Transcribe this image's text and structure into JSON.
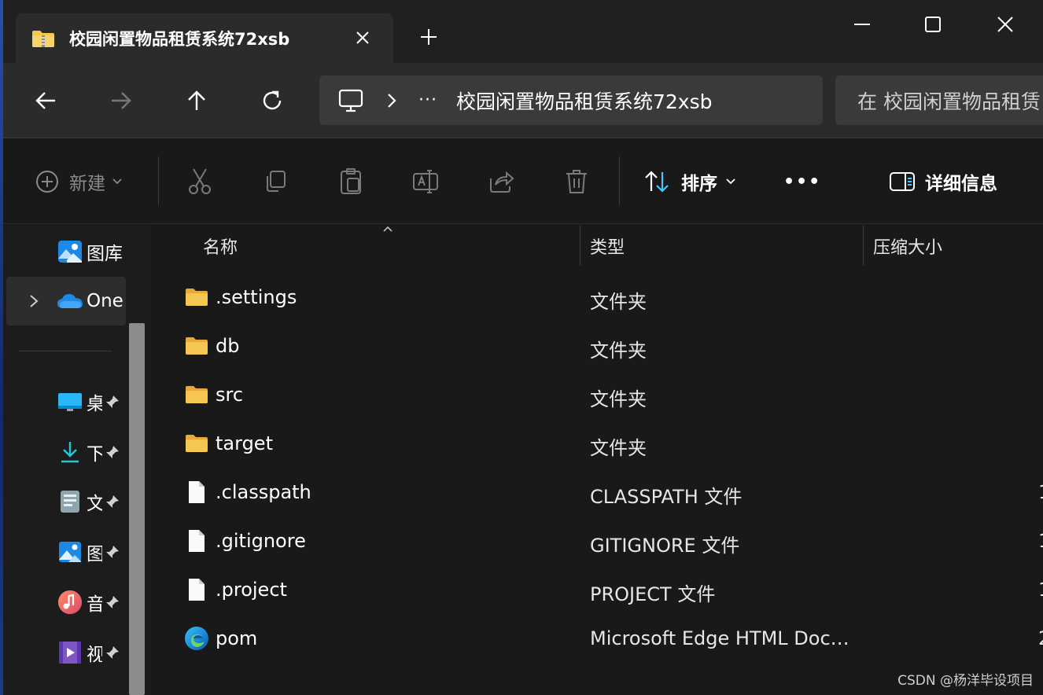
{
  "window": {
    "tab_title": "校园闲置物品租赁系统72xsb",
    "tab_icon": "zip-folder-icon"
  },
  "address": {
    "path_text": "校园闲置物品租赁系统72xsb",
    "more_label": "···",
    "search_placeholder": "在 校园闲置物品租赁"
  },
  "command_bar": {
    "new_label": "新建",
    "sort_label": "排序",
    "more_label": "•••",
    "details_label": "详细信息"
  },
  "sidebar": {
    "items": [
      {
        "label": "图库",
        "icon": "gallery-icon"
      },
      {
        "label": "One",
        "icon": "onedrive-icon"
      },
      {
        "label": "桌",
        "icon": "desktop-icon"
      },
      {
        "label": "下",
        "icon": "downloads-icon"
      },
      {
        "label": "文",
        "icon": "documents-icon"
      },
      {
        "label": "图",
        "icon": "pictures-icon"
      },
      {
        "label": "音",
        "icon": "music-icon"
      },
      {
        "label": "视",
        "icon": "videos-icon"
      }
    ]
  },
  "columns": {
    "name": "名称",
    "type": "类型",
    "compressed_size": "压缩大小"
  },
  "files": [
    {
      "name": ".settings",
      "type": "文件夹",
      "size": "",
      "icon": "folder-icon"
    },
    {
      "name": "db",
      "type": "文件夹",
      "size": "",
      "icon": "folder-icon"
    },
    {
      "name": "src",
      "type": "文件夹",
      "size": "",
      "icon": "folder-icon"
    },
    {
      "name": "target",
      "type": "文件夹",
      "size": "",
      "icon": "folder-icon"
    },
    {
      "name": ".classpath",
      "type": "CLASSPATH 文件",
      "size": "1",
      "icon": "file-icon"
    },
    {
      "name": ".gitignore",
      "type": "GITIGNORE 文件",
      "size": "1",
      "icon": "file-icon"
    },
    {
      "name": ".project",
      "type": "PROJECT 文件",
      "size": "1",
      "icon": "file-icon"
    },
    {
      "name": "pom",
      "type": "Microsoft Edge HTML Docu...",
      "size": "2",
      "icon": "edge-icon"
    }
  ],
  "watermark": "CSDN @杨洋毕设项目",
  "colors": {
    "folder": "#f4c752",
    "accent": "#4cc2ff"
  }
}
